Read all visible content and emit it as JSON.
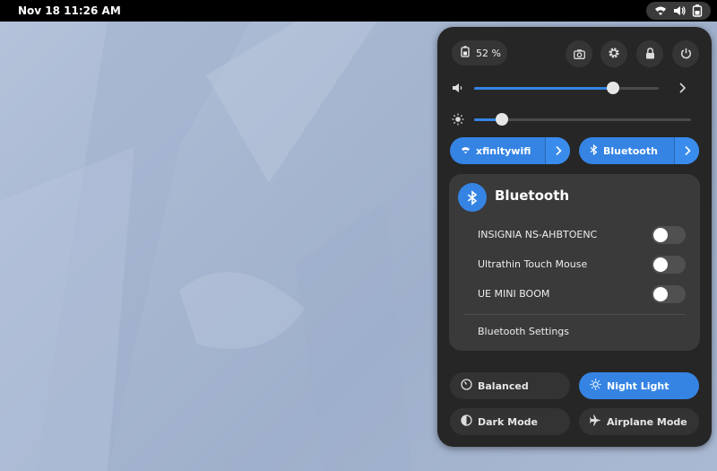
{
  "topbar": {
    "clock": "Nov 18  11:26 AM",
    "tray_icons": [
      "wifi-icon",
      "volume-icon",
      "battery-icon"
    ]
  },
  "panel": {
    "battery_label": "52 %",
    "system_buttons": [
      "screenshot-icon",
      "settings-icon",
      "lock-icon",
      "power-icon"
    ],
    "volume_level": 0.75,
    "brightness_level": 0.13,
    "wifi_toggle": {
      "label": "xfinitywifi",
      "icon": "wifi-icon",
      "active": true
    },
    "bluetooth_toggle": {
      "label": "Bluetooth",
      "icon": "bluetooth-icon",
      "active": true
    },
    "bluetooth_menu": {
      "title": "Bluetooth",
      "devices": [
        {
          "name": "INSIGNIA NS-AHBTOENC",
          "connected": false
        },
        {
          "name": "Ultrathin Touch Mouse",
          "connected": false
        },
        {
          "name": "UE MINI BOOM",
          "connected": false
        }
      ],
      "settings_label": "Bluetooth Settings"
    },
    "quick_settings": [
      {
        "label": "Balanced",
        "icon": "power-profile-icon",
        "active": false
      },
      {
        "label": "Night Light",
        "icon": "night-light-icon",
        "active": true
      },
      {
        "label": "Dark Mode",
        "icon": "dark-mode-icon",
        "active": false
      },
      {
        "label": "Airplane Mode",
        "icon": "airplane-icon",
        "active": false
      }
    ]
  },
  "colors": {
    "accent": "#3584e4",
    "panel_bg": "#262626",
    "menu_bg": "#3a3a3a",
    "desktop_bg": "#a9b8d1"
  }
}
